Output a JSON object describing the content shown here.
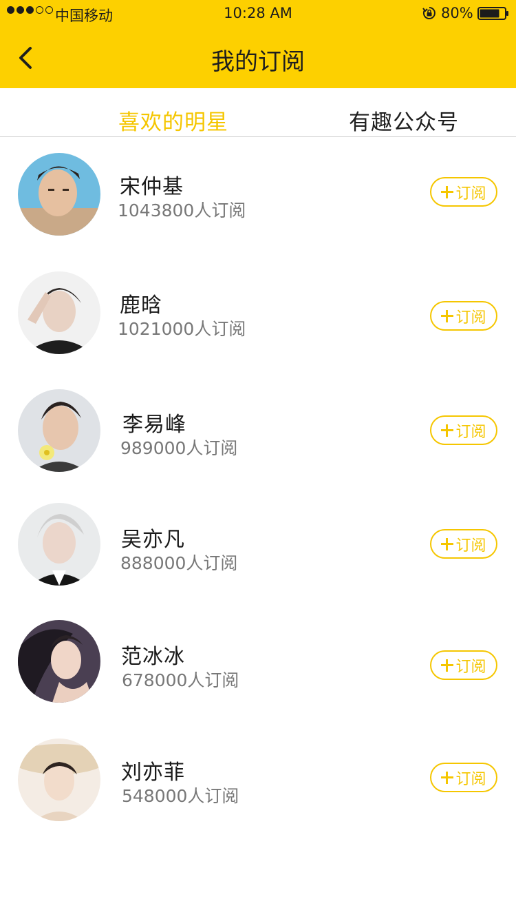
{
  "status_bar": {
    "carrier": "中国移动",
    "time": "10:28 AM",
    "battery_percent": "80%",
    "battery_level": 0.8,
    "signal_bars_filled": 3,
    "signal_bars_total": 5
  },
  "nav": {
    "title": "我的订阅",
    "back_icon": "chevron-left-icon"
  },
  "tabs": [
    {
      "label": "喜欢的明星",
      "active": true
    },
    {
      "label": "有趣公众号",
      "active": false
    }
  ],
  "subscribe_label": "订阅",
  "stars": [
    {
      "name": "宋仲基",
      "subscribers": "1043800人订阅"
    },
    {
      "name": "鹿晗",
      "subscribers": "1021000人订阅"
    },
    {
      "name": "李易峰",
      "subscribers": "989000人订阅"
    },
    {
      "name": "吴亦凡",
      "subscribers": "888000人订阅"
    },
    {
      "name": "范冰冰",
      "subscribers": "678000人订阅"
    },
    {
      "name": "刘亦菲",
      "subscribers": "548000人订阅"
    }
  ],
  "colors": {
    "accent": "#FDD000",
    "accent_text": "#F5C600",
    "text_primary": "#1a1a1a",
    "text_secondary": "#777777"
  }
}
